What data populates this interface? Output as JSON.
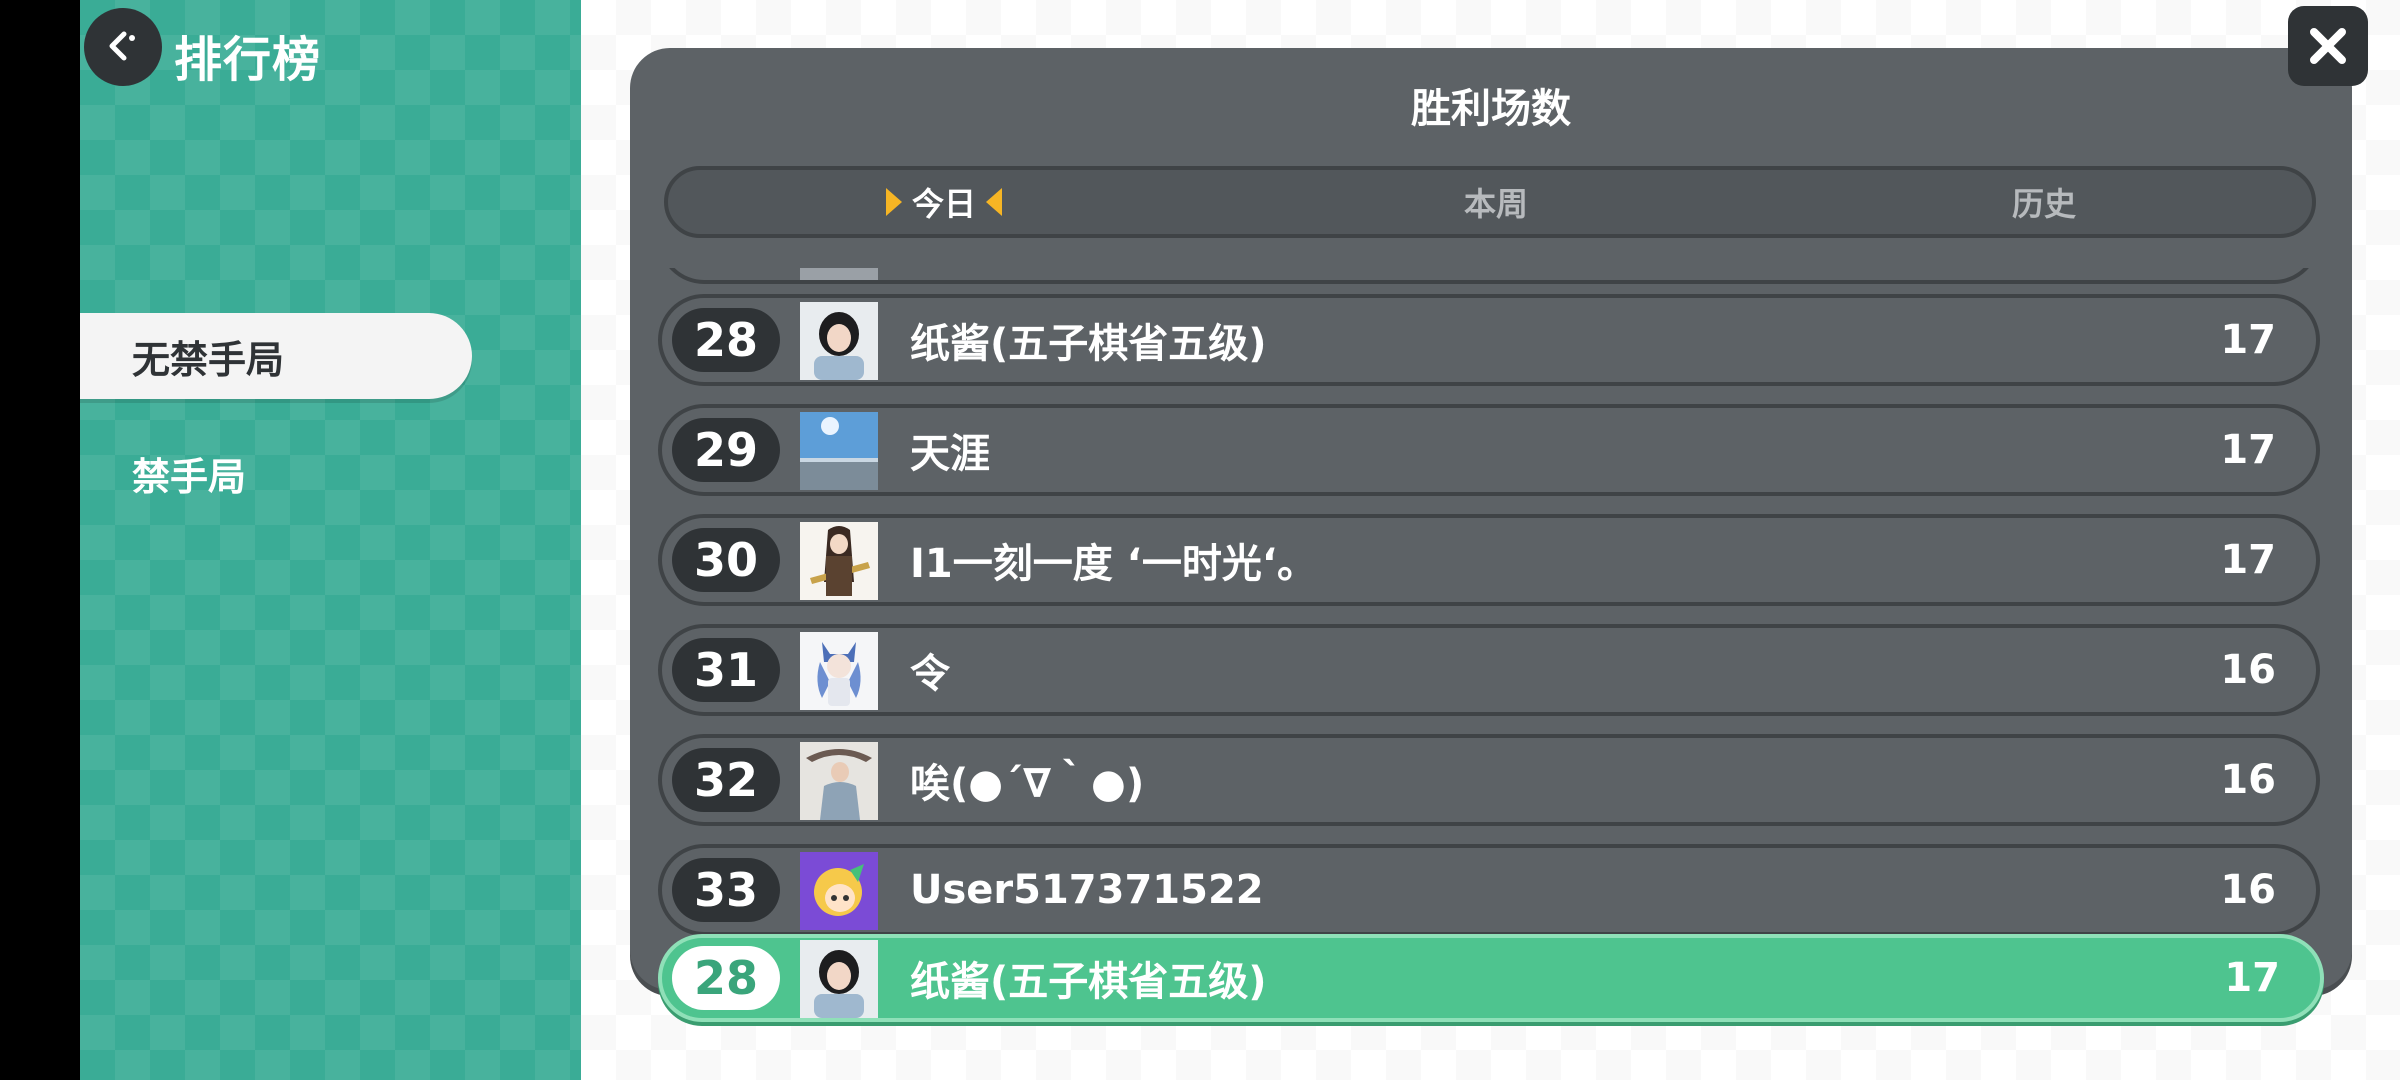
{
  "header": {
    "title": "排行榜",
    "back_icon": "back-arrow-icon"
  },
  "sidebar": {
    "items": [
      {
        "label": "无禁手局",
        "active": true
      },
      {
        "label": "禁手局",
        "active": false
      }
    ]
  },
  "panel": {
    "title": "胜利场数",
    "tabs": [
      {
        "label": "今日",
        "active": true
      },
      {
        "label": "本周",
        "active": false
      },
      {
        "label": "历史",
        "active": false
      }
    ]
  },
  "leaderboard": {
    "rows": [
      {
        "rank": "28",
        "name": "纸酱(五子棋省五级)",
        "score": "17"
      },
      {
        "rank": "29",
        "name": "天涯",
        "score": "17"
      },
      {
        "rank": "30",
        "name": "I1一刻一度 ‘一时光‘。",
        "score": "17"
      },
      {
        "rank": "31",
        "name": "令",
        "score": "16"
      },
      {
        "rank": "32",
        "name": "唉(●´∇｀●)",
        "score": "16"
      },
      {
        "rank": "33",
        "name": "User517371522",
        "score": "16"
      }
    ],
    "self": {
      "rank": "28",
      "name": "纸酱(五子棋省五级)",
      "score": "17"
    }
  },
  "colors": {
    "sidebar_teal": "#3aac96",
    "panel_gray": "#5d6266",
    "self_green": "#4ec48f",
    "tab_marker": "#f6b524"
  },
  "close_icon": "close-icon"
}
